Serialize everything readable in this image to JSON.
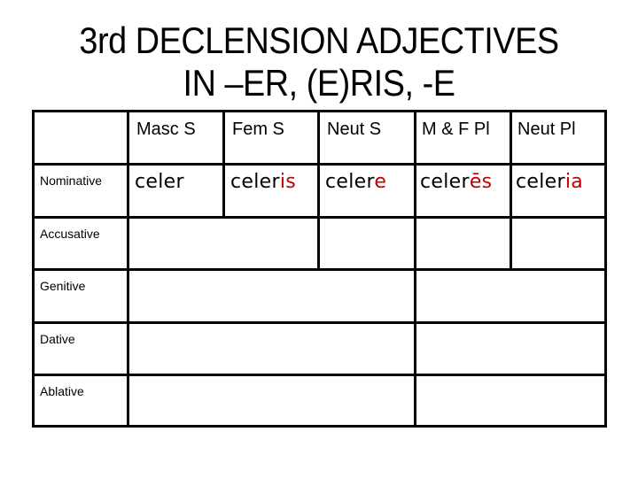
{
  "title": {
    "line1": "3rd DECLENSION ADJECTIVES",
    "line2": "IN –ER, (E)RIS, -E"
  },
  "table": {
    "corner": "",
    "columns": [
      "Masc S",
      "Fem S",
      "Neut S",
      "M & F Pl",
      "Neut Pl"
    ],
    "rows": [
      {
        "case": "Nominative",
        "cells": [
          {
            "stem": "celer",
            "ending": ""
          },
          {
            "stem": "celer",
            "ending": "is"
          },
          {
            "stem": "celer",
            "ending": "e"
          },
          {
            "stem": "celer",
            "ending": "ēs"
          },
          {
            "stem": "celer",
            "ending": "ia"
          }
        ]
      },
      {
        "case": "Accusative",
        "cells": [
          {
            "span": "Masc S + Fem S",
            "value": ""
          },
          {
            "span": "Neut S",
            "value": ""
          },
          {
            "span": "M & F Pl",
            "value": ""
          },
          {
            "span": "Neut Pl",
            "value": ""
          }
        ]
      },
      {
        "case": "Genitive",
        "cells": [
          {
            "span": "Singular (all genders)",
            "value": ""
          },
          {
            "span": "Plural (all genders)",
            "value": ""
          }
        ]
      },
      {
        "case": "Dative",
        "cells": [
          {
            "span": "Singular (all genders)",
            "value": ""
          },
          {
            "span": "Plural (all genders)",
            "value": ""
          }
        ]
      },
      {
        "case": "Ablative",
        "cells": [
          {
            "span": "Singular (all genders)",
            "value": ""
          },
          {
            "span": "Plural (all genders)",
            "value": ""
          }
        ]
      }
    ]
  },
  "colors": {
    "ending_highlight": "#C00000",
    "text": "#000000",
    "grid": "#000000",
    "background": "#FFFFFF"
  }
}
